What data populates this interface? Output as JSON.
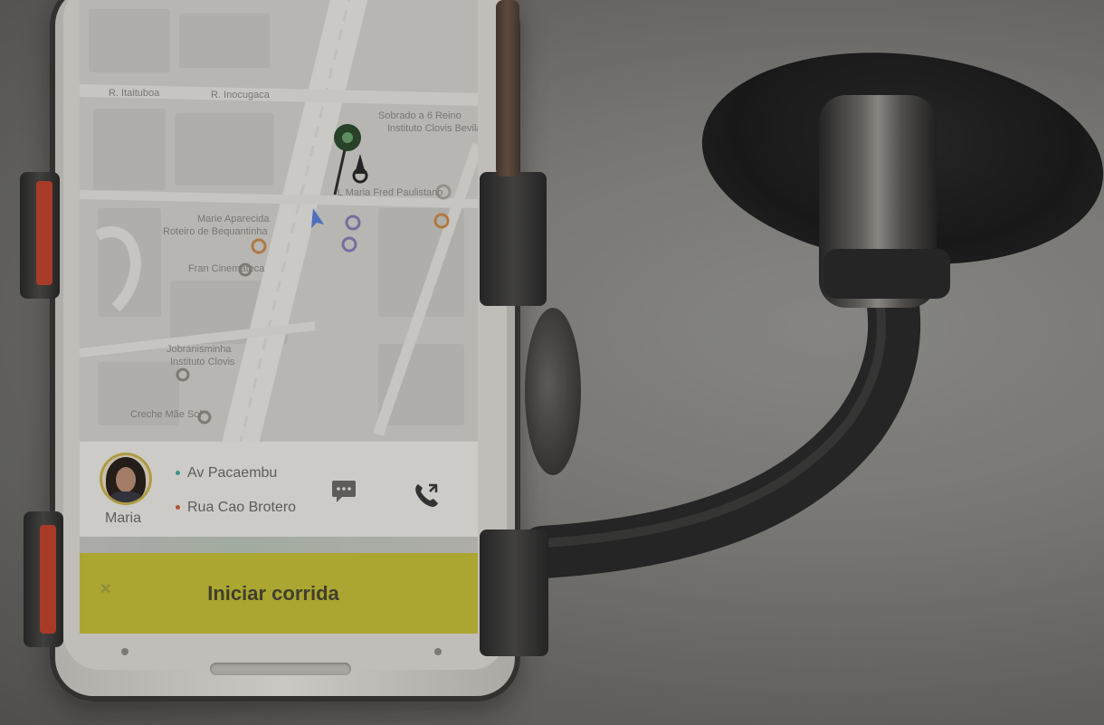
{
  "photo": {
    "description_tags": [
      "smartphone",
      "car-mount",
      "ride-hailing-app"
    ]
  },
  "map": {
    "labels": [
      "R. Itaituboa",
      "R. Inocugaca",
      "Sobrado a 6 Reino",
      "Instituto Clovis Bevilaqua",
      "L Maria Fred Paulistano",
      "Marie Aparecida",
      "Roteiro de Bequantinha",
      "Fran Cinemateca",
      "Jobranisminha",
      "Instituto Clovis",
      "Creche Mãe Sol"
    ],
    "marker_color": "#2e4a2f",
    "route_color": "#2f2f2f",
    "accent_purple": "#8a7bb5",
    "accent_orange": "#c98a4c"
  },
  "ride_card": {
    "driver_name": "Maria",
    "pickup": "Av Pacaembu",
    "dropoff": "Rua Cao Brotero",
    "pickup_color": "#4aa3a0",
    "dropoff_color": "#c9603d",
    "chat_icon": "chat-icon",
    "call_icon": "phone-icon"
  },
  "action": {
    "start_label": "Iniciar corrida",
    "close_symbol": "✕",
    "button_color": "#c3be3a"
  }
}
